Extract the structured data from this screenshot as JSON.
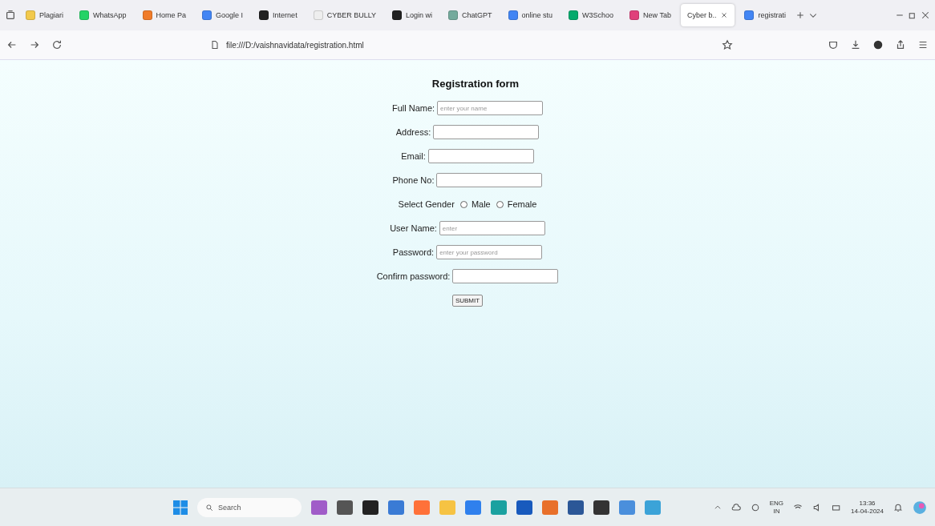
{
  "browser": {
    "tabs": [
      {
        "label": "Plagiari",
        "selected": false
      },
      {
        "label": "WhatsApp",
        "selected": false
      },
      {
        "label": "Home Pa",
        "selected": false
      },
      {
        "label": "Google I",
        "selected": false
      },
      {
        "label": "Internet",
        "selected": false
      },
      {
        "label": "CYBER BULLY",
        "selected": false
      },
      {
        "label": "Login wi",
        "selected": false
      },
      {
        "label": "ChatGPT",
        "selected": false
      },
      {
        "label": "online stu",
        "selected": false
      },
      {
        "label": "W3Schoo",
        "selected": false
      },
      {
        "label": "New Tab",
        "selected": false
      },
      {
        "label": "Cyber b..",
        "selected": true
      },
      {
        "label": "registrati",
        "selected": false
      }
    ],
    "address": "file:///D:/vaishnavidata/registration.html"
  },
  "form": {
    "title": "Registration form",
    "rows": [
      {
        "kind": "text",
        "label": "Full Name:",
        "placeholder": "enter your name"
      },
      {
        "kind": "text",
        "label": "Address:"
      },
      {
        "kind": "text",
        "label": "Email:"
      },
      {
        "kind": "text",
        "label": "Phone No:"
      },
      {
        "kind": "radio",
        "label": "Select Gender",
        "options": [
          {
            "label": "Male",
            "selected": false
          },
          {
            "label": "Female",
            "selected": false
          }
        ]
      },
      {
        "kind": "text",
        "label": "User Name:",
        "placeholder": "enter"
      },
      {
        "kind": "text",
        "label": "Password:",
        "placeholder": "enter your password"
      },
      {
        "kind": "text",
        "label": "Confirm password:"
      },
      {
        "kind": "submit",
        "label": "SUBMIT"
      }
    ]
  },
  "taskbar": {
    "search": "Search",
    "language": "ENG",
    "region": "IN",
    "time": "13:36",
    "date": "14-04-2024"
  }
}
